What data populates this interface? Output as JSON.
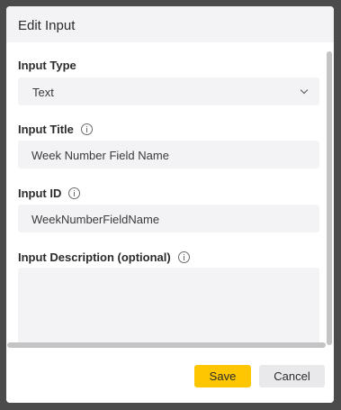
{
  "dialog": {
    "title": "Edit Input",
    "input_type": {
      "label": "Input Type",
      "value": "Text"
    },
    "input_title": {
      "label": "Input Title",
      "value": "Week Number Field Name"
    },
    "input_id": {
      "label": "Input ID",
      "value": "WeekNumberFieldName"
    },
    "input_description": {
      "label": "Input Description (optional)",
      "value": ""
    },
    "buttons": {
      "save": "Save",
      "cancel": "Cancel"
    }
  },
  "colors": {
    "overlay": "#4b4b4b",
    "field_bg": "#f3f3f6",
    "primary": "#fdc600",
    "secondary_button": "#e9e9ec"
  }
}
